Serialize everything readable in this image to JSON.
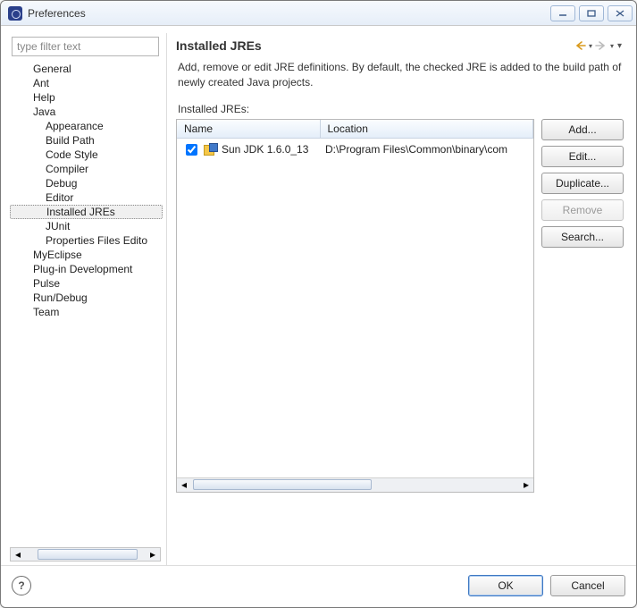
{
  "window": {
    "title": "Preferences"
  },
  "sidebar": {
    "filter_placeholder": "type filter text",
    "items": [
      {
        "label": "General",
        "level": 0
      },
      {
        "label": "Ant",
        "level": 0
      },
      {
        "label": "Help",
        "level": 0
      },
      {
        "label": "Java",
        "level": 0
      },
      {
        "label": "Appearance",
        "level": 1
      },
      {
        "label": "Build Path",
        "level": 1
      },
      {
        "label": "Code Style",
        "level": 1
      },
      {
        "label": "Compiler",
        "level": 1
      },
      {
        "label": "Debug",
        "level": 1
      },
      {
        "label": "Editor",
        "level": 1
      },
      {
        "label": "Installed JREs",
        "level": 1,
        "selected": true
      },
      {
        "label": "JUnit",
        "level": 1
      },
      {
        "label": "Properties Files Edito",
        "level": 1
      },
      {
        "label": "MyEclipse",
        "level": 0
      },
      {
        "label": "Plug-in Development",
        "level": 0
      },
      {
        "label": "Pulse",
        "level": 0
      },
      {
        "label": "Run/Debug",
        "level": 0
      },
      {
        "label": "Team",
        "level": 0
      }
    ]
  },
  "main": {
    "heading": "Installed JREs",
    "description": "Add, remove or edit JRE definitions. By default, the checked JRE is added to the build path of newly created Java projects.",
    "list_label": "Installed JREs:",
    "columns": {
      "name": "Name",
      "location": "Location"
    },
    "rows": [
      {
        "checked": true,
        "name": "Sun JDK 1.6.0_13",
        "location": "D:\\Program Files\\Common\\binary\\com"
      }
    ],
    "buttons": {
      "add": "Add...",
      "edit": "Edit...",
      "duplicate": "Duplicate...",
      "remove": "Remove",
      "search": "Search..."
    }
  },
  "footer": {
    "help_symbol": "?",
    "ok": "OK",
    "cancel": "Cancel"
  }
}
